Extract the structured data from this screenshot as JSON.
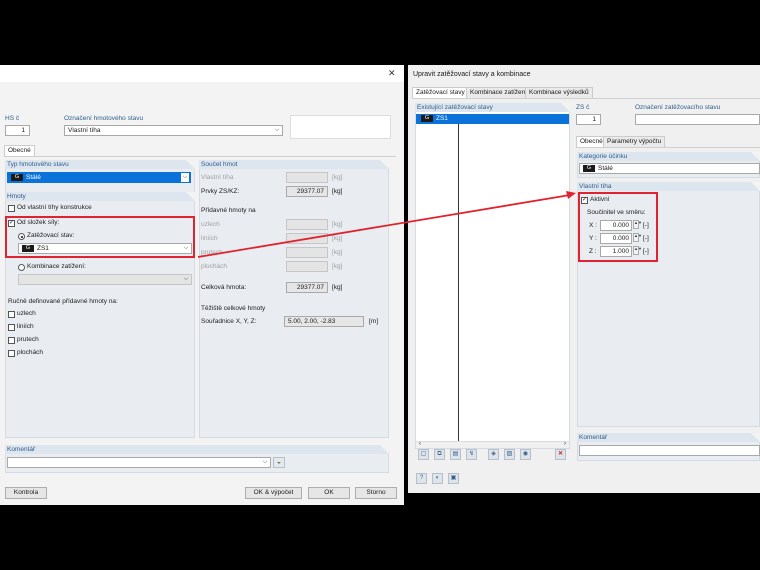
{
  "left_dialog": {
    "close_icon": "✕",
    "hs_label": "HS č",
    "hs_value": "1",
    "name_label": "Označení hmotového stavu",
    "name_value": "Vlastní tíha",
    "tab_general": "Obecné",
    "mass_type_label": "Typ hmotového stavu",
    "mass_type_chip": "G",
    "mass_type_value": "Stálé",
    "masses_label": "Hmoty",
    "self_weight_label": "Od vlastní tíhy konstrukce",
    "from_loads_label": "Od složek síly:",
    "load_case_radio_label": "Zatěžovací stav:",
    "load_case_chip": "G",
    "load_case_value": "ZS1",
    "combination_radio_label": "Kombinace zatížení:",
    "manual_label": "Ručně definované přídavné hmoty na:",
    "manual_items": [
      "uzlech",
      "liniích",
      "prutech",
      "plochách"
    ],
    "mass_sum_label": "Součet hmot",
    "self_weight_field_label": "Vlastní tíha",
    "elements_label": "Prvky ZS/KZ:",
    "elements_value": "29377.07",
    "unit_kg": "[kg]",
    "additional_label": "Přídavné hmoty na",
    "additional_items": [
      "uzlech",
      "liniích",
      "prutech",
      "plochách"
    ],
    "total_label": "Celková hmota:",
    "total_value": "29377.07",
    "centroid_label": "Těžiště celkové hmoty",
    "coords_label": "Souřadnice X, Y, Z:",
    "coords_value": "5.00, 2.00, -2.83",
    "unit_m": "[m]",
    "comment_label": "Komentář",
    "buttons": {
      "check": "Kontrola",
      "ok_calc": "OK & výpočet",
      "ok": "OK",
      "cancel": "Storno"
    }
  },
  "right_dialog": {
    "title": "Upravit zatěžovací stavy a kombinace",
    "tabs": [
      "Zatěžovací stavy",
      "Kombinace zatížení",
      "Kombinace výsledků"
    ],
    "existing_label": "Existující zatěžovací stavy",
    "list_chip": "G",
    "list_item": "ZS1",
    "zs_label": "ZS č",
    "zs_value": "1",
    "name_label": "Označení zatěžovacího stavu",
    "inner_tabs": [
      "Obecné",
      "Parametry výpočtu"
    ],
    "category_label": "Kategorie účinku",
    "category_chip": "G",
    "category_value": "Stálé",
    "self_weight_label": "Vlastní tíha",
    "active_label": "Aktivní",
    "factor_label": "Součinitel ve směru:",
    "factors": [
      {
        "axis": "X :",
        "value": "0.000",
        "unit": "[-]"
      },
      {
        "axis": "Y :",
        "value": "0.000",
        "unit": "[-]"
      },
      {
        "axis": "Z :",
        "value": "1.000",
        "unit": "[-]"
      }
    ],
    "comment_label": "Komentář"
  },
  "colors": {
    "annotation": "#e0242f",
    "accent": "#2f5d8c",
    "selection": "#0a72d8"
  }
}
